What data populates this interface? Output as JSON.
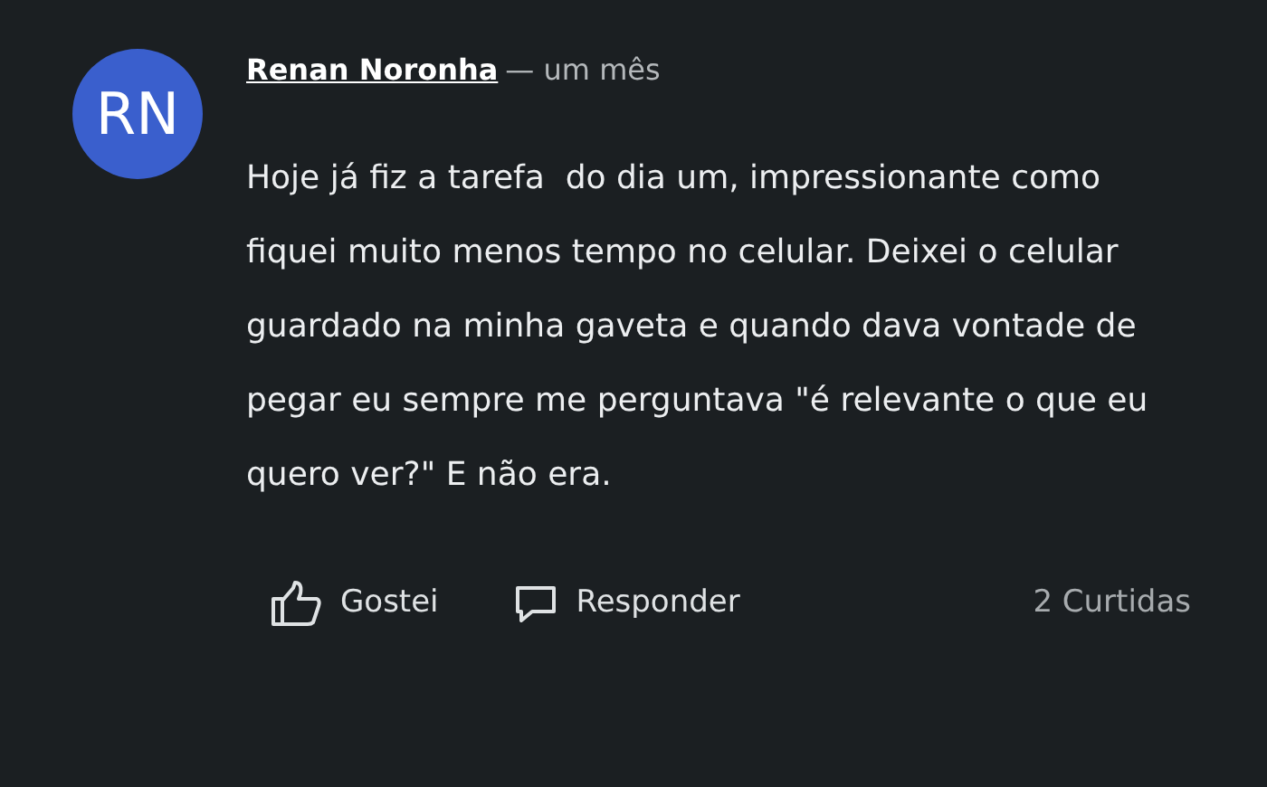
{
  "comment": {
    "avatar": {
      "initials": "RN",
      "color": "#3a5fcd"
    },
    "author": "Renan Noronha",
    "time": "— um mês",
    "text": "Hoje já fiz a tarefa  do dia um, impressionante como fiquei muito menos tempo no celular. Deixei o celular guardado na minha gaveta e quando dava vontade de pegar eu sempre me perguntava \"é relevante o que eu quero ver?\" E não era.",
    "actions": [
      {
        "kind": "like",
        "label": "Gostei"
      },
      {
        "kind": "reply",
        "label": "Responder"
      }
    ],
    "likes": "2 Curtidas"
  }
}
